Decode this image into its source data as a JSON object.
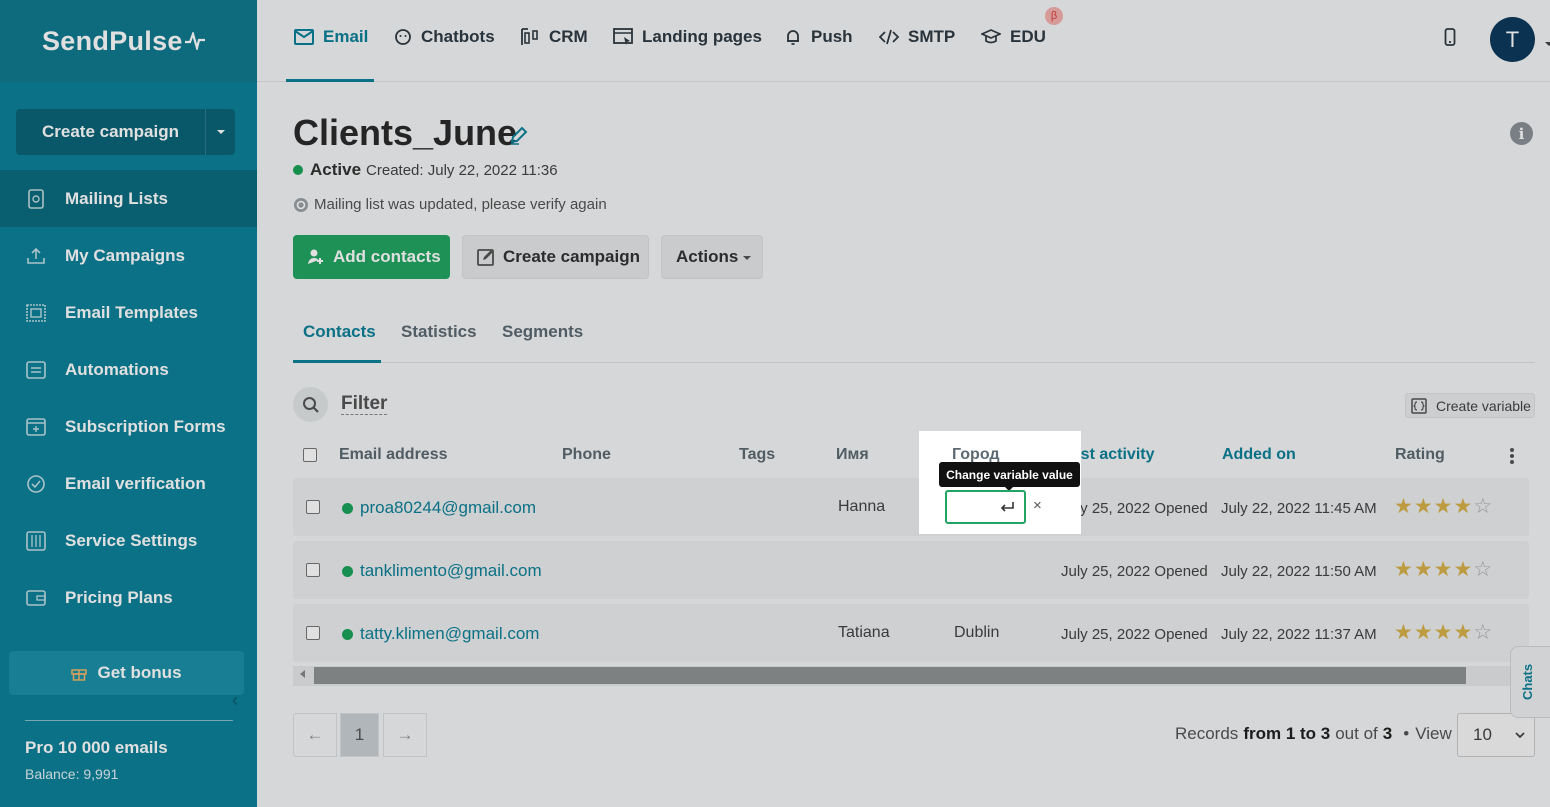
{
  "app": {
    "logo": "SendPulse",
    "create_campaign_label": "Create campaign"
  },
  "sidebar": {
    "items": [
      {
        "label": "Mailing Lists",
        "icon": "address-book-icon"
      },
      {
        "label": "My Campaigns",
        "icon": "upload-icon"
      },
      {
        "label": "Email Templates",
        "icon": "template-icon"
      },
      {
        "label": "Automations",
        "icon": "automation-icon"
      },
      {
        "label": "Subscription Forms",
        "icon": "form-icon"
      },
      {
        "label": "Email verification",
        "icon": "check-circle-icon"
      },
      {
        "label": "Service Settings",
        "icon": "sliders-icon"
      },
      {
        "label": "Pricing Plans",
        "icon": "wallet-icon"
      }
    ],
    "active_index": 0,
    "bonus_label": "Get bonus",
    "plan": "Pro 10 000 emails",
    "balance": "Balance: 9,991"
  },
  "topnav": {
    "tabs": [
      {
        "label": "Email",
        "icon": "envelope-icon"
      },
      {
        "label": "Chatbots",
        "icon": "chat-icon"
      },
      {
        "label": "CRM",
        "icon": "crm-icon"
      },
      {
        "label": "Landing pages",
        "icon": "landing-icon"
      },
      {
        "label": "Push",
        "icon": "bell-icon"
      },
      {
        "label": "SMTP",
        "icon": "code-icon"
      },
      {
        "label": "EDU",
        "icon": "graduation-cap-icon"
      }
    ],
    "beta_badge": "β",
    "avatar_letter": "T"
  },
  "page": {
    "title": "Clients_June",
    "status": "Active",
    "created": "Created: July 22, 2022 11:36",
    "notice": "Mailing list was updated, please verify again",
    "buttons": {
      "add_contacts": "Add contacts",
      "create_campaign": "Create campaign",
      "actions": "Actions"
    },
    "subtabs": [
      "Contacts",
      "Statistics",
      "Segments"
    ],
    "filter_label": "Filter",
    "create_variable": "Create variable"
  },
  "table": {
    "columns": [
      "Email address",
      "Phone",
      "Tags",
      "Имя",
      "Город",
      "Last activity",
      "Added on",
      "Rating"
    ],
    "rows": [
      {
        "email": "proa80244@gmail.com",
        "phone": "",
        "tags": "",
        "name": "Hanna",
        "city": "",
        "last_activity": "July 25, 2022 Opened",
        "added_on": "July 22, 2022 11:45 AM",
        "rating": 4
      },
      {
        "email": "tanklimento@gmail.com",
        "phone": "",
        "tags": "",
        "name": "",
        "city": "",
        "last_activity": "July 25, 2022 Opened",
        "added_on": "July 22, 2022 11:50 AM",
        "rating": 4
      },
      {
        "email": "tatty.klimen@gmail.com",
        "phone": "",
        "tags": "",
        "name": "Tatiana",
        "city": "Dublin",
        "last_activity": "July 25, 2022 Opened",
        "added_on": "July 22, 2022 11:37 AM",
        "rating": 4
      }
    ],
    "tooltip": "Change variable value",
    "var_input_value": "",
    "close_symbol": "×"
  },
  "pagination": {
    "prev": "←",
    "current": "1",
    "next": "→",
    "records_prefix": "Records",
    "records_range": "from 1 to 3",
    "records_mid": "out of",
    "records_total": "3",
    "separator": "•",
    "view_label": "View",
    "view_value": "10"
  },
  "chats_label": "Chats",
  "colors": {
    "sidebar": "#0d8199",
    "accent": "#0d8199",
    "green": "#23a562",
    "star": "#d6b14a"
  }
}
